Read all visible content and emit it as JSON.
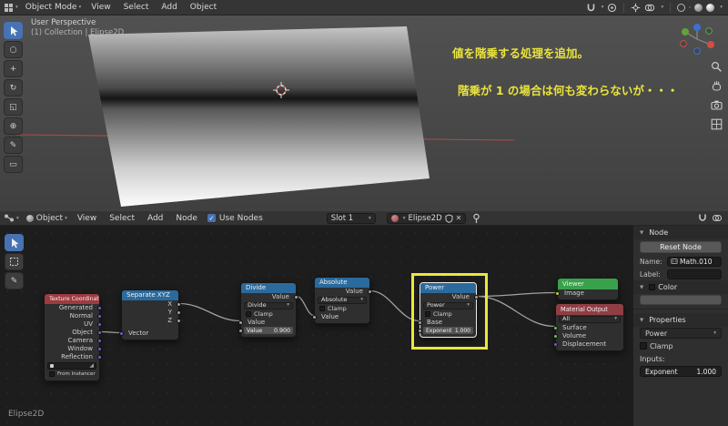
{
  "colors": {
    "accent_blue": "#4772b3",
    "annotation_yellow": "#e9e43b",
    "highlight_box_yellow": "#ebe73a",
    "header_input_node": "#9d3b40",
    "header_converter_node": "#2b6a9c",
    "header_viewer_node": "#39a14c",
    "header_output_node": "#8f3e44"
  },
  "icons": {
    "dropdown_arrow": "▾",
    "panel_triangle": "▼",
    "check": "✓",
    "close": "✕"
  },
  "viewport": {
    "header": {
      "mode": "Object Mode",
      "menus": [
        "View",
        "Select",
        "Add",
        "Object"
      ]
    },
    "overlay": {
      "perspective": "User Perspective",
      "collection": "(1) Collection | Elipse2D"
    },
    "annotations": {
      "line1": "値を階乗する処理を追加。",
      "line2": "階乗が 1 の場合は何も変わらないが・・・"
    },
    "tool_glyphs": [
      "○",
      "+",
      "↻",
      "◱",
      "⊕",
      "✎",
      "▭"
    ]
  },
  "node_editor": {
    "header": {
      "shader_type": "Object",
      "menus": [
        "View",
        "Select",
        "Add",
        "Node"
      ],
      "use_nodes_label": "Use Nodes",
      "slot": "Slot 1",
      "material_name": "Elipse2D"
    },
    "status": "Elipse2D",
    "nodes": {
      "texture_coordinate": {
        "title": "Texture Coordinate",
        "outputs": [
          "Generated",
          "Normal",
          "UV",
          "Object",
          "Camera",
          "Window",
          "Reflection"
        ],
        "from_instancer_label": "From Instancer"
      },
      "separate_xyz": {
        "title": "Separate XYZ",
        "outputs": [
          "X",
          "Y",
          "Z"
        ],
        "input_label": "Vector"
      },
      "divide": {
        "title": "Divide",
        "output_label": "Value",
        "operation": "Divide",
        "clamp_label": "Clamp",
        "input_label": "Value",
        "value_label": "Value",
        "value": "0.900"
      },
      "absolute": {
        "title": "Absolute",
        "output_label": "Value",
        "operation": "Absolute",
        "clamp_label": "Clamp",
        "input_label": "Value"
      },
      "power": {
        "title": "Power",
        "output_label": "Value",
        "operation": "Power",
        "clamp_label": "Clamp",
        "input_label": "Base",
        "exponent_label": "Exponent",
        "exponent_value": "1.000"
      },
      "viewer": {
        "title": "Viewer",
        "input_label": "Image"
      },
      "material_output": {
        "title": "Material Output",
        "target": "All",
        "inputs": [
          "Surface",
          "Volume",
          "Displacement"
        ]
      }
    },
    "sidebar": {
      "panel_title": "Node",
      "reset_button": "Reset Node",
      "name_label": "Name:",
      "name_value": "Math.010",
      "label_label": "Label:",
      "label_value": "",
      "color_label": "Color",
      "properties_label": "Properties",
      "operation_value": "Power",
      "clamp_label": "Clamp",
      "inputs_label": "Inputs:",
      "exponent_label": "Exponent",
      "exponent_value": "1.000"
    }
  }
}
